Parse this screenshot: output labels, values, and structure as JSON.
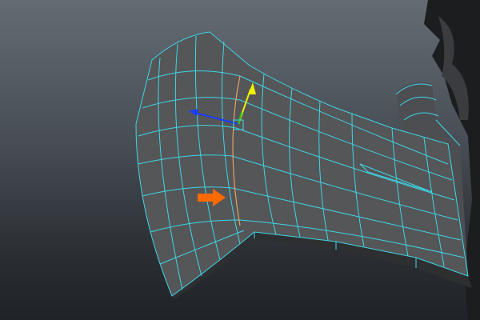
{
  "viewport": {
    "type": "3d-modeling-viewport",
    "mesh": "axe-blade-polygon-mesh",
    "colors": {
      "wireframe": "#3fd6e6",
      "surface": "#555555",
      "selected_edge": "#e8a060",
      "annotation_arrow": "#ff6a00",
      "manip_x": "#1a3cff",
      "manip_y": "#f0f000",
      "manip_z": "#20c020"
    },
    "icons": [
      "move-manipulator-icon",
      "annotation-arrow-icon"
    ]
  }
}
